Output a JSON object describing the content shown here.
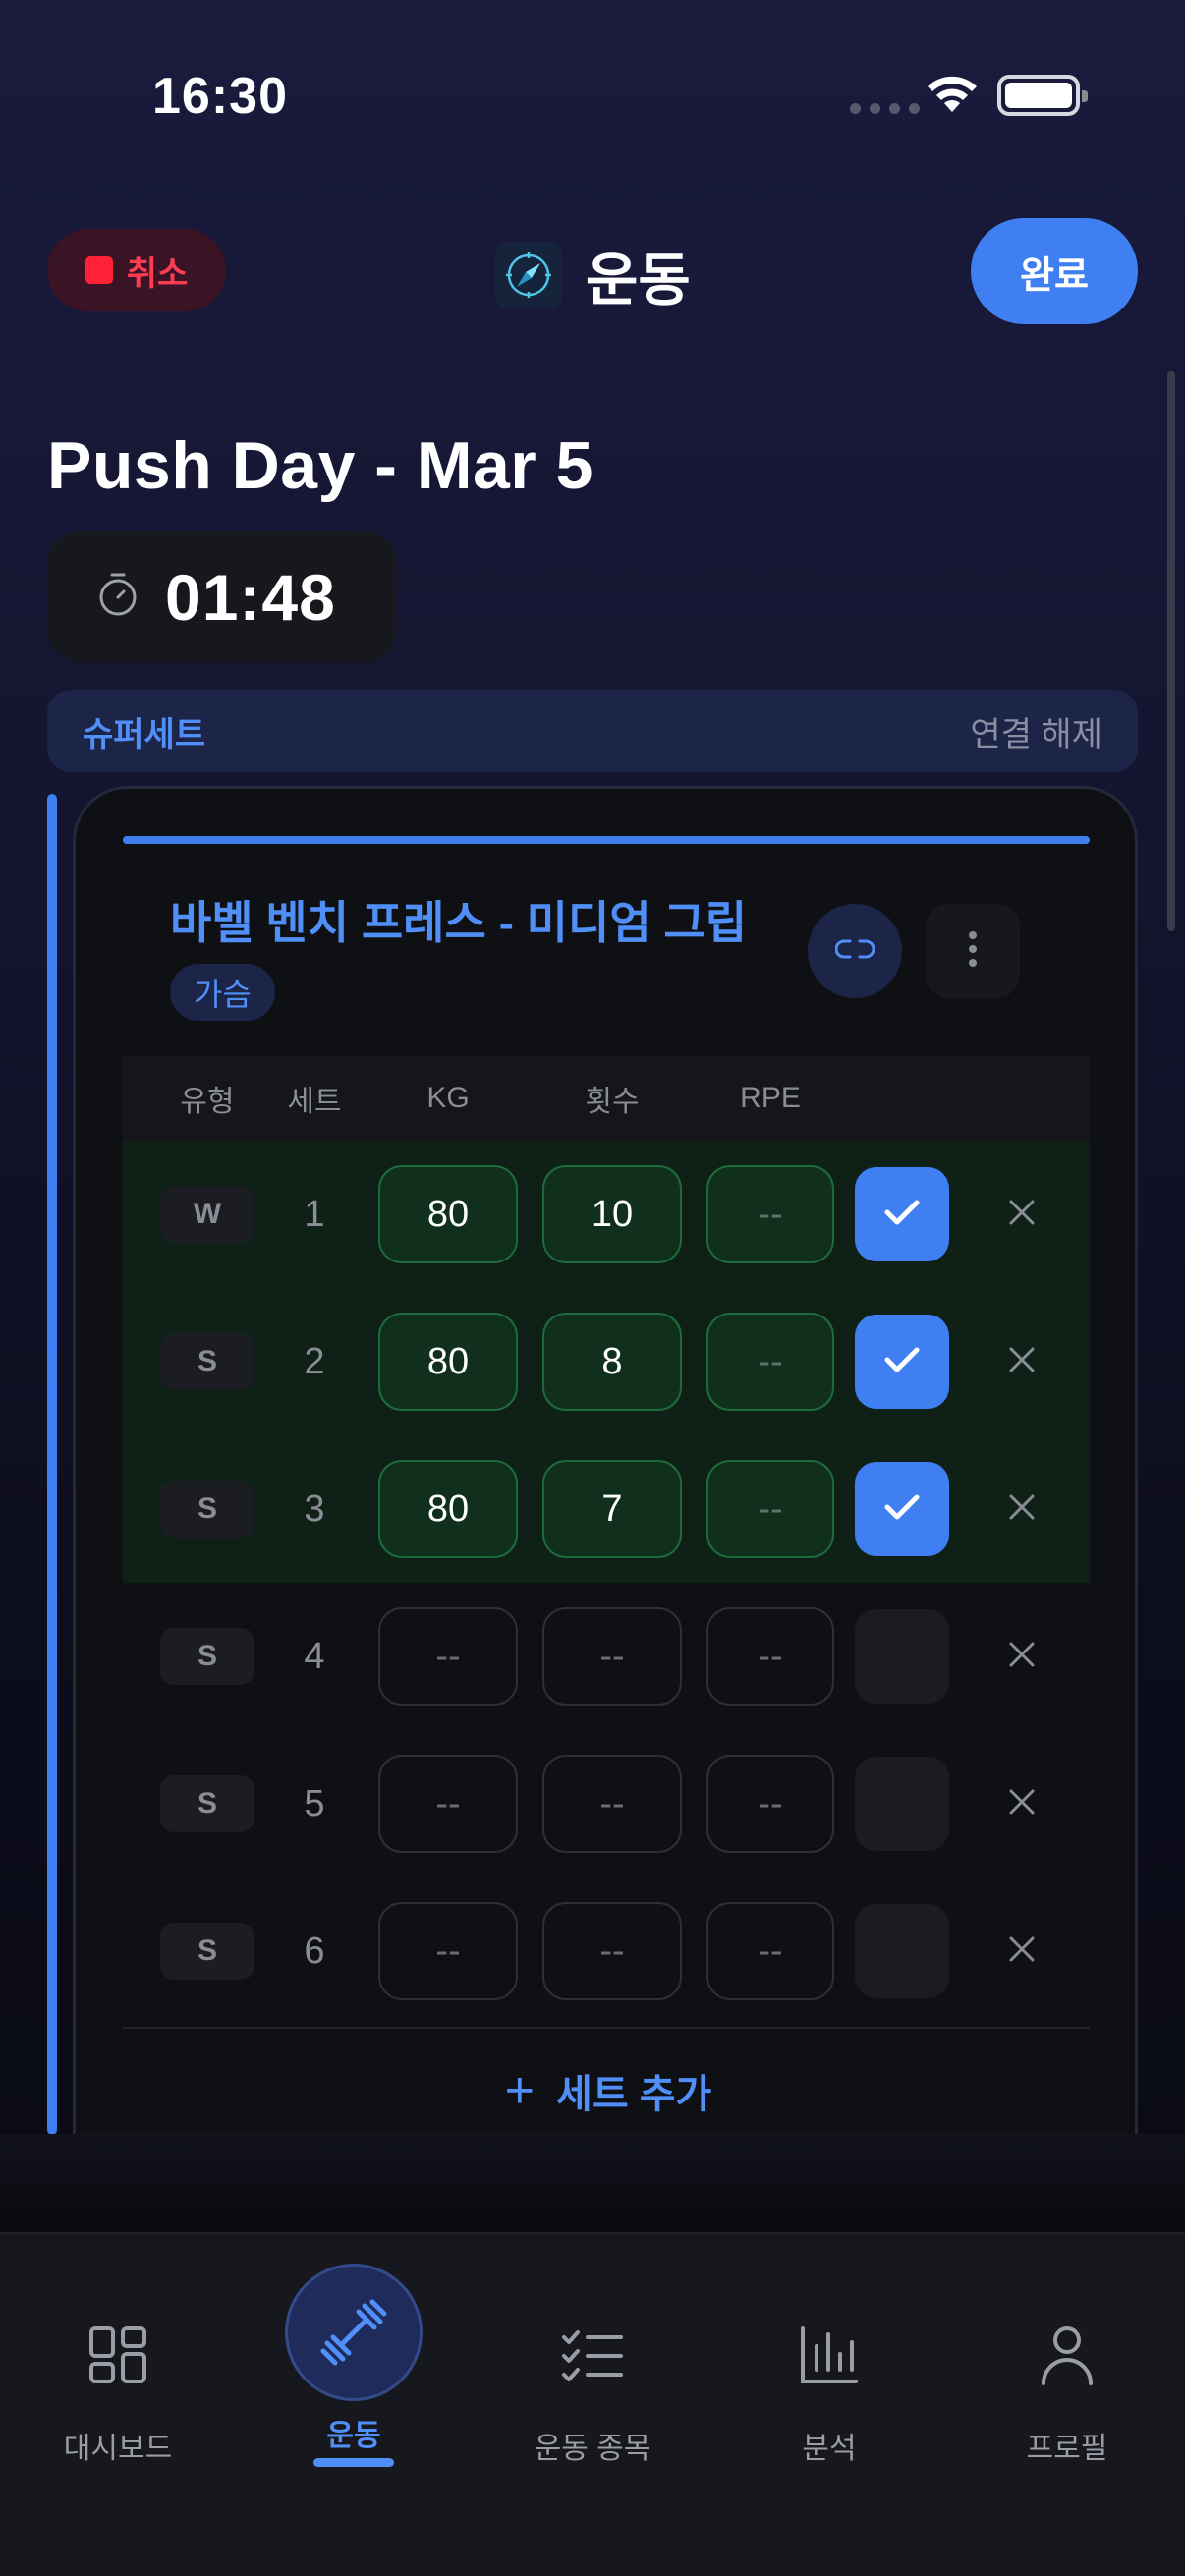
{
  "status_bar": {
    "time": "16:30"
  },
  "header": {
    "cancel_label": "취소",
    "title": "운동",
    "done_label": "완료"
  },
  "workout": {
    "title": "Push Day - Mar 5",
    "elapsed": "01:48"
  },
  "superset": {
    "label": "슈퍼세트",
    "unlink_label": "연결 해제"
  },
  "exercise": {
    "name": "바벨 벤치 프레스 - 미디엄 그립",
    "muscle_tag": "가슴",
    "columns": [
      "유형",
      "세트",
      "KG",
      "횟수",
      "RPE"
    ],
    "sets": [
      {
        "type": "W",
        "num": "1",
        "kg": "80",
        "reps": "10",
        "rpe": "--",
        "done": true
      },
      {
        "type": "S",
        "num": "2",
        "kg": "80",
        "reps": "8",
        "rpe": "--",
        "done": true
      },
      {
        "type": "S",
        "num": "3",
        "kg": "80",
        "reps": "7",
        "rpe": "--",
        "done": true
      },
      {
        "type": "S",
        "num": "4",
        "kg": "--",
        "reps": "--",
        "rpe": "--",
        "done": false
      },
      {
        "type": "S",
        "num": "5",
        "kg": "--",
        "reps": "--",
        "rpe": "--",
        "done": false
      },
      {
        "type": "S",
        "num": "6",
        "kg": "--",
        "reps": "--",
        "rpe": "--",
        "done": false
      }
    ],
    "add_set_label": "세트 추가"
  },
  "tabs": [
    {
      "label": "대시보드",
      "icon": "grid-icon",
      "active": false
    },
    {
      "label": "운동",
      "icon": "dumbbell-icon",
      "active": true
    },
    {
      "label": "운동 종목",
      "icon": "checklist-icon",
      "active": false
    },
    {
      "label": "분석",
      "icon": "bar-chart-icon",
      "active": false
    },
    {
      "label": "프로필",
      "icon": "person-icon",
      "active": false
    }
  ],
  "colors": {
    "accent": "#3f7ff2",
    "cancel": "#ff2236",
    "done_row": "#0f2117"
  }
}
